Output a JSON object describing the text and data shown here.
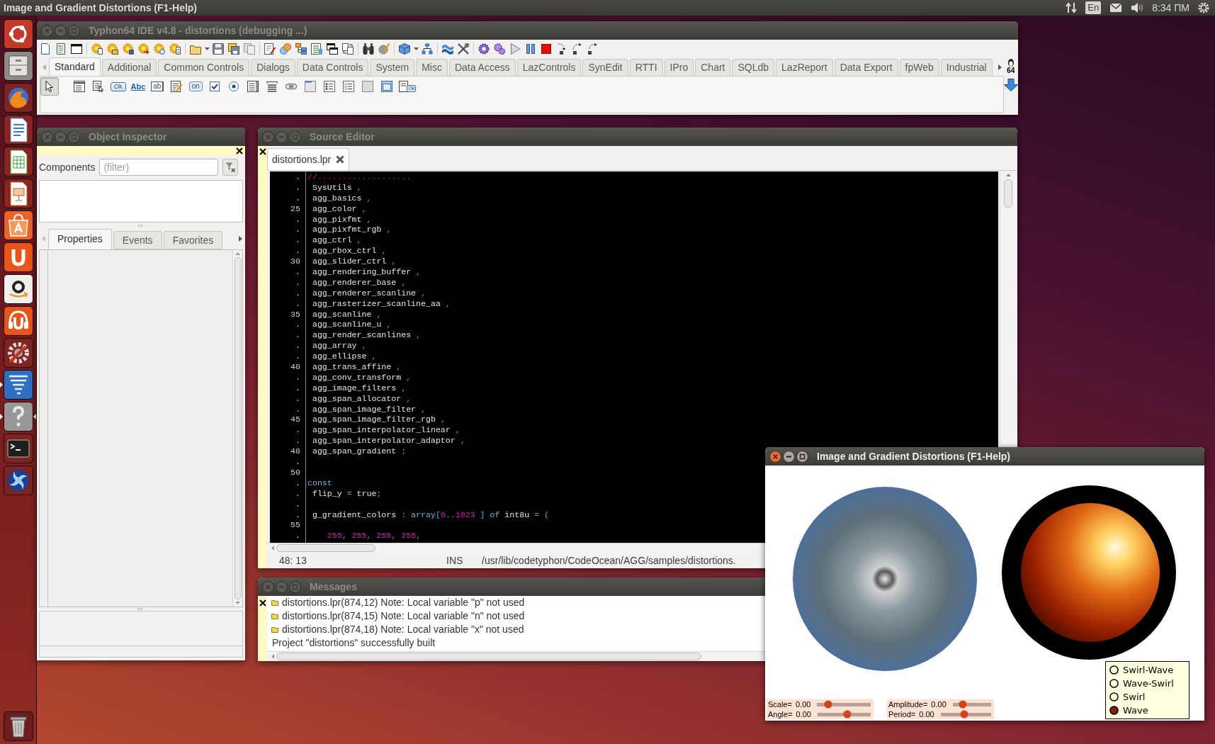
{
  "top_panel": {
    "title": "Image and Gradient Distortions (F1-Help)",
    "keyboard_layout": "En",
    "clock": "8:34 ПМ"
  },
  "launcher": {
    "items": [
      {
        "kind": "dash",
        "running": false,
        "focused": false
      },
      {
        "kind": "files",
        "running": false,
        "focused": false
      },
      {
        "kind": "browser",
        "running": false,
        "focused": false
      },
      {
        "kind": "writer",
        "running": false,
        "focused": false
      },
      {
        "kind": "calc",
        "running": false,
        "focused": false
      },
      {
        "kind": "impress",
        "running": false,
        "focused": false
      },
      {
        "kind": "store",
        "running": false,
        "focused": false
      },
      {
        "kind": "cloud",
        "running": false,
        "focused": false
      },
      {
        "kind": "shop",
        "running": false,
        "focused": false
      },
      {
        "kind": "music",
        "running": false,
        "focused": false
      },
      {
        "kind": "settings",
        "running": false,
        "focused": false
      },
      {
        "kind": "tornado",
        "running": true,
        "focused": false
      },
      {
        "kind": "help",
        "running": true,
        "focused": true
      },
      {
        "kind": "terminal",
        "running": false,
        "focused": false
      },
      {
        "kind": "swirl",
        "running": false,
        "focused": false
      },
      {
        "kind": "trash",
        "running": false,
        "focused": false
      }
    ]
  },
  "ide_window": {
    "title": "Typhon64 IDE v4.8 - distortions (debugging ...)",
    "focused": false,
    "palette_tabs": [
      {
        "label": "Standard",
        "selected": true
      },
      {
        "label": "Additional",
        "selected": false
      },
      {
        "label": "Common Controls",
        "selected": false
      },
      {
        "label": "Dialogs",
        "selected": false
      },
      {
        "label": "Data Controls",
        "selected": false
      },
      {
        "label": "System",
        "selected": false
      },
      {
        "label": "Misc",
        "selected": false
      },
      {
        "label": "Data Access",
        "selected": false
      },
      {
        "label": "LazControls",
        "selected": false
      },
      {
        "label": "SynEdit",
        "selected": false
      },
      {
        "label": "RTTI",
        "selected": false
      },
      {
        "label": "IPro",
        "selected": false
      },
      {
        "label": "Chart",
        "selected": false
      },
      {
        "label": "SQLdb",
        "selected": false
      },
      {
        "label": "LazReport",
        "selected": false
      },
      {
        "label": "Data Export",
        "selected": false
      },
      {
        "label": "fpWeb",
        "selected": false
      },
      {
        "label": "Industrial",
        "selected": false
      }
    ],
    "palette_items": [
      {
        "kind": "pointer",
        "selected": true
      },
      {
        "kind": "mainmenu",
        "selected": false
      },
      {
        "kind": "popupmenu",
        "selected": false
      },
      {
        "kind": "button",
        "caption": "Ok",
        "selected": false
      },
      {
        "kind": "label",
        "caption": "Abc",
        "selected": false
      },
      {
        "kind": "edit",
        "caption": "ab",
        "selected": false
      },
      {
        "kind": "memo",
        "selected": false
      },
      {
        "kind": "toggle",
        "caption": "on",
        "selected": false
      },
      {
        "kind": "checkbox",
        "selected": false
      },
      {
        "kind": "radio",
        "selected": false
      },
      {
        "kind": "listbox",
        "selected": false
      },
      {
        "kind": "combobox",
        "selected": false
      },
      {
        "kind": "scrollbar",
        "selected": false
      },
      {
        "kind": "groupbox",
        "selected": false
      },
      {
        "kind": "radiogroup",
        "selected": false
      },
      {
        "kind": "checkgroup",
        "selected": false
      },
      {
        "kind": "panel",
        "selected": false
      },
      {
        "kind": "frame",
        "selected": false
      },
      {
        "kind": "actionlist",
        "caption": "Ok",
        "selected": false
      }
    ],
    "platform_badge": "64"
  },
  "object_inspector": {
    "title": "Object Inspector",
    "focused": false,
    "components_label": "Components",
    "filter": {
      "placeholder": "(filter)"
    },
    "tabs": [
      {
        "label": "Properties",
        "selected": true
      },
      {
        "label": "Events",
        "selected": false
      },
      {
        "label": "Favorites",
        "selected": false
      }
    ]
  },
  "source_editor": {
    "title": "Source Editor",
    "focused": false,
    "file_tabs": [
      {
        "label": "distortions.lpr",
        "selected": true
      }
    ],
    "lines": [
      {
        "gutter": ".",
        "tokens": [
          {
            "kind": "comment",
            "text": "//..................."
          }
        ]
      },
      {
        "gutter": ".",
        "tokens": [
          {
            "kind": "ident",
            "text": " SysUtils"
          },
          {
            "kind": "symbol",
            "text": " ,"
          }
        ]
      },
      {
        "gutter": ".",
        "tokens": [
          {
            "kind": "ident",
            "text": " agg_basics"
          },
          {
            "kind": "symbol",
            "text": " ,"
          }
        ]
      },
      {
        "gutter": "25",
        "tokens": [
          {
            "kind": "ident",
            "text": " agg_color"
          },
          {
            "kind": "symbol",
            "text": " ,"
          }
        ]
      },
      {
        "gutter": ".",
        "tokens": [
          {
            "kind": "ident",
            "text": " agg_pixfmt"
          },
          {
            "kind": "symbol",
            "text": " ,"
          }
        ]
      },
      {
        "gutter": ".",
        "tokens": [
          {
            "kind": "ident",
            "text": " agg_pixfmt_rgb"
          },
          {
            "kind": "symbol",
            "text": " ,"
          }
        ]
      },
      {
        "gutter": ".",
        "tokens": [
          {
            "kind": "ident",
            "text": " agg_ctrl"
          },
          {
            "kind": "symbol",
            "text": " ,"
          }
        ]
      },
      {
        "gutter": ".",
        "tokens": [
          {
            "kind": "ident",
            "text": " agg_rbox_ctrl"
          },
          {
            "kind": "symbol",
            "text": " ,"
          }
        ]
      },
      {
        "gutter": "30",
        "tokens": [
          {
            "kind": "ident",
            "text": " agg_slider_ctrl"
          },
          {
            "kind": "symbol",
            "text": " ,"
          }
        ]
      },
      {
        "gutter": ".",
        "tokens": [
          {
            "kind": "ident",
            "text": " agg_rendering_buffer"
          },
          {
            "kind": "symbol",
            "text": " ,"
          }
        ]
      },
      {
        "gutter": ".",
        "tokens": [
          {
            "kind": "ident",
            "text": " agg_renderer_base"
          },
          {
            "kind": "symbol",
            "text": " ,"
          }
        ]
      },
      {
        "gutter": ".",
        "tokens": [
          {
            "kind": "ident",
            "text": " agg_renderer_scanline"
          },
          {
            "kind": "symbol",
            "text": " ,"
          }
        ]
      },
      {
        "gutter": ".",
        "tokens": [
          {
            "kind": "ident",
            "text": " agg_rasterizer_scanline_aa"
          },
          {
            "kind": "symbol",
            "text": " ,"
          }
        ]
      },
      {
        "gutter": "35",
        "tokens": [
          {
            "kind": "ident",
            "text": " agg_scanline"
          },
          {
            "kind": "symbol",
            "text": " ,"
          }
        ]
      },
      {
        "gutter": ".",
        "tokens": [
          {
            "kind": "ident",
            "text": " agg_scanline_u"
          },
          {
            "kind": "symbol",
            "text": " ,"
          }
        ]
      },
      {
        "gutter": ".",
        "tokens": [
          {
            "kind": "ident",
            "text": " agg_render_scanlines"
          },
          {
            "kind": "symbol",
            "text": " ,"
          }
        ]
      },
      {
        "gutter": ".",
        "tokens": [
          {
            "kind": "ident",
            "text": " agg_array"
          },
          {
            "kind": "symbol",
            "text": " ,"
          }
        ]
      },
      {
        "gutter": ".",
        "tokens": [
          {
            "kind": "ident",
            "text": " agg_ellipse"
          },
          {
            "kind": "symbol",
            "text": " ,"
          }
        ]
      },
      {
        "gutter": "40",
        "tokens": [
          {
            "kind": "ident",
            "text": " agg_trans_affine"
          },
          {
            "kind": "symbol",
            "text": " ,"
          }
        ]
      },
      {
        "gutter": ".",
        "tokens": [
          {
            "kind": "ident",
            "text": " agg_conv_transform"
          },
          {
            "kind": "symbol",
            "text": " ,"
          }
        ]
      },
      {
        "gutter": ".",
        "tokens": [
          {
            "kind": "ident",
            "text": " agg_image_filters"
          },
          {
            "kind": "symbol",
            "text": " ,"
          }
        ]
      },
      {
        "gutter": ".",
        "tokens": [
          {
            "kind": "ident",
            "text": " agg_span_allocator"
          },
          {
            "kind": "symbol",
            "text": " ,"
          }
        ]
      },
      {
        "gutter": ".",
        "tokens": [
          {
            "kind": "ident",
            "text": " agg_span_image_filter"
          },
          {
            "kind": "symbol",
            "text": " ,"
          }
        ]
      },
      {
        "gutter": "45",
        "tokens": [
          {
            "kind": "ident",
            "text": " agg_span_image_filter_rgb"
          },
          {
            "kind": "symbol",
            "text": " ,"
          }
        ]
      },
      {
        "gutter": ".",
        "tokens": [
          {
            "kind": "ident",
            "text": " agg_span_interpolator_linear"
          },
          {
            "kind": "symbol",
            "text": " ,"
          }
        ]
      },
      {
        "gutter": ".",
        "tokens": [
          {
            "kind": "ident",
            "text": " agg_span_interpolator_adaptor"
          },
          {
            "kind": "symbol",
            "text": " ,"
          }
        ]
      },
      {
        "gutter": "48",
        "tokens": [
          {
            "kind": "ident",
            "text": " agg_span_gradient"
          },
          {
            "kind": "symbol",
            "text": " ;"
          }
        ]
      },
      {
        "gutter": "."
      },
      {
        "gutter": "50"
      },
      {
        "gutter": ".",
        "tokens": [
          {
            "kind": "keyword",
            "text": "const"
          }
        ]
      },
      {
        "gutter": ".",
        "tokens": [
          {
            "kind": "ident",
            "text": " flip_y"
          },
          {
            "kind": "symbol",
            "text": " ="
          },
          {
            "kind": "ident",
            "text": " true"
          },
          {
            "kind": "symbol",
            "text": ";"
          }
        ]
      },
      {
        "gutter": "."
      },
      {
        "gutter": ".",
        "tokens": [
          {
            "kind": "ident",
            "text": " g_gradient_colors"
          },
          {
            "kind": "symbol",
            "text": " :"
          },
          {
            "kind": "keyword",
            "text": " array"
          },
          {
            "kind": "symbol",
            "text": "["
          },
          {
            "kind": "number",
            "text": "0"
          },
          {
            "kind": "symbol",
            "text": ".."
          },
          {
            "kind": "number",
            "text": "1023"
          },
          {
            "kind": "symbol",
            "text": " ]"
          },
          {
            "kind": "keyword",
            "text": " of"
          },
          {
            "kind": "ident",
            "text": " int8u"
          },
          {
            "kind": "symbol",
            "text": " = ("
          }
        ]
      },
      {
        "gutter": "55"
      },
      {
        "gutter": ".",
        "tokens": [
          {
            "kind": "number",
            "text": "    255"
          },
          {
            "kind": "symbol",
            "text": ","
          },
          {
            "kind": "number",
            "text": " 255"
          },
          {
            "kind": "symbol",
            "text": ","
          },
          {
            "kind": "number",
            "text": " 255"
          },
          {
            "kind": "symbol",
            "text": ","
          },
          {
            "kind": "number",
            "text": " 255"
          },
          {
            "kind": "symbol",
            "text": ","
          }
        ]
      }
    ],
    "status_bar": {
      "position": "48: 13",
      "mode": "INS",
      "path": "/usr/lib/codetyphon/CodeOcean/AGG/samples/distortions."
    }
  },
  "messages": {
    "title": "Messages",
    "focused": false,
    "items": [
      {
        "kind": "note",
        "text": "distortions.lpr(874,12) Note: Local variable \"p\" not used"
      },
      {
        "kind": "note",
        "text": "distortions.lpr(874,15) Note: Local variable \"n\" not used"
      },
      {
        "kind": "note",
        "text": "distortions.lpr(874,18) Note: Local variable \"x\" not used"
      },
      {
        "kind": "info",
        "text": "Project \"distortions\" successfully built"
      }
    ]
  },
  "demo_window": {
    "title": "Image and Gradient Distortions (F1-Help)",
    "focused": true,
    "sliders": [
      {
        "label": "Scale=",
        "reading": "0.00",
        "level": 0.21
      },
      {
        "label": "Angle=",
        "reading": "0.00",
        "level": 0.56
      },
      {
        "label": "Amplitude=",
        "reading": "0.00",
        "level": 0.26
      },
      {
        "label": "Period=",
        "reading": "0.00",
        "level": 0.47
      }
    ],
    "effects": [
      {
        "label": "Swirl-Wave",
        "selected": false
      },
      {
        "label": "Wave-Swirl",
        "selected": false
      },
      {
        "label": "Swirl",
        "selected": false
      },
      {
        "label": "Wave",
        "selected": true
      }
    ]
  }
}
